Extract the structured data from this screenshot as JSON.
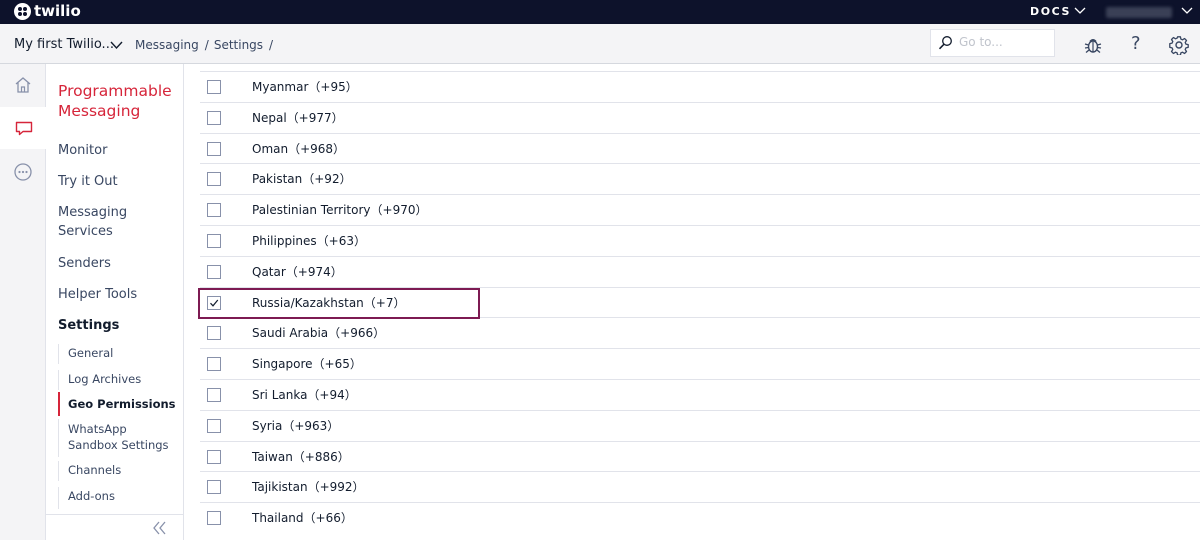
{
  "brand": {
    "name": "twilio"
  },
  "topbar": {
    "docs_label": "DOCS"
  },
  "header": {
    "project_name": "My first Twilio...",
    "breadcrumbs": [
      "Messaging",
      "Settings"
    ],
    "breadcrumb_sep": "/",
    "search_placeholder": "Go to...",
    "help_label": "?"
  },
  "rail": {
    "items": [
      {
        "icon": "home-icon",
        "active": false
      },
      {
        "icon": "chat-icon",
        "active": true
      },
      {
        "icon": "more-icon",
        "active": false
      }
    ]
  },
  "sidebar": {
    "title": "Programmable Messaging",
    "items": [
      "Monitor",
      "Try it Out",
      "Messaging Services",
      "Senders",
      "Helper Tools",
      "Settings"
    ],
    "active_item": "Settings",
    "subitems": [
      "General",
      "Log Archives",
      "Geo Permissions",
      "WhatsApp Sandbox Settings",
      "Channels",
      "Add-ons"
    ],
    "active_subitem": "Geo Permissions"
  },
  "countries": [
    {
      "label": "Myanmar（+95）",
      "checked": false
    },
    {
      "label": "Nepal（+977）",
      "checked": false
    },
    {
      "label": "Oman（+968）",
      "checked": false
    },
    {
      "label": "Pakistan（+92）",
      "checked": false
    },
    {
      "label": "Palestinian Territory（+970）",
      "checked": false
    },
    {
      "label": "Philippines（+63）",
      "checked": false
    },
    {
      "label": "Qatar（+974）",
      "checked": false
    },
    {
      "label": "Russia/Kazakhstan（+7）",
      "checked": true
    },
    {
      "label": "Saudi Arabia（+966）",
      "checked": false
    },
    {
      "label": "Singapore（+65）",
      "checked": false
    },
    {
      "label": "Sri Lanka（+94）",
      "checked": false
    },
    {
      "label": "Syria（+963）",
      "checked": false
    },
    {
      "label": "Taiwan（+886）",
      "checked": false
    },
    {
      "label": "Tajikistan（+992）",
      "checked": false
    },
    {
      "label": "Thailand（+66）",
      "checked": false
    }
  ],
  "colors": {
    "brand_red": "#d6253a",
    "topbar": "#0d122b",
    "highlight": "#7d1a52"
  }
}
